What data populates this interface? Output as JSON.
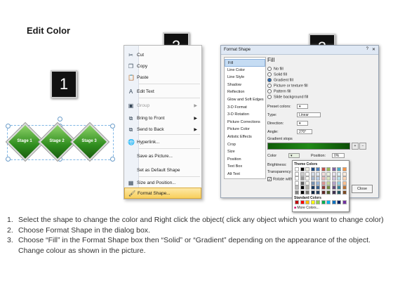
{
  "title": "Edit Color",
  "badges": [
    "1",
    "2",
    "3"
  ],
  "diagram": {
    "stages": [
      "Stage 1",
      "Stage 2",
      "Stage 3"
    ],
    "color": "#2f8d1e"
  },
  "context_menu": {
    "items": [
      {
        "label": "Cut",
        "icon": "scissors-icon",
        "glyph": "✂",
        "disabled": false,
        "submenu": false
      },
      {
        "label": "Copy",
        "icon": "copy-icon",
        "glyph": "❐",
        "disabled": false,
        "submenu": false
      },
      {
        "label": "Paste",
        "icon": "paste-icon",
        "glyph": "📋",
        "disabled": false,
        "submenu": false
      },
      {
        "label": "Edit Text",
        "icon": "text-icon",
        "glyph": "A",
        "disabled": false,
        "submenu": false
      },
      {
        "label": "Group",
        "icon": "group-icon",
        "glyph": "▣",
        "disabled": true,
        "submenu": true
      },
      {
        "label": "Bring to Front",
        "icon": "bring-front-icon",
        "glyph": "⧉",
        "disabled": false,
        "submenu": true
      },
      {
        "label": "Send to Back",
        "icon": "send-back-icon",
        "glyph": "⧉",
        "disabled": false,
        "submenu": true
      },
      {
        "label": "Hyperlink...",
        "icon": "link-icon",
        "glyph": "🌐",
        "disabled": false,
        "submenu": false
      },
      {
        "label": "Save as Picture...",
        "icon": "",
        "glyph": "",
        "disabled": false,
        "submenu": false
      },
      {
        "label": "Set as Default Shape",
        "icon": "",
        "glyph": "",
        "disabled": false,
        "submenu": false
      },
      {
        "label": "Size and Position...",
        "icon": "size-icon",
        "glyph": "▦",
        "disabled": false,
        "submenu": false
      },
      {
        "label": "Format Shape...",
        "icon": "format-shape-icon",
        "glyph": "🖌",
        "disabled": false,
        "submenu": false,
        "highlighted": true
      }
    ]
  },
  "dialog": {
    "title": "Format Shape",
    "nav": [
      "Fill",
      "Line Color",
      "Line Style",
      "Shadow",
      "Reflection",
      "Glow and Soft Edges",
      "3-D Format",
      "3-D Rotation",
      "Picture Corrections",
      "Picture Color",
      "Artistic Effects",
      "Crop",
      "Size",
      "Position",
      "Text Box",
      "Alt Text"
    ],
    "selected_nav": "Fill",
    "section_title": "Fill",
    "fill_options": [
      "No fill",
      "Solid fill",
      "Gradient fill",
      "Picture or texture fill",
      "Pattern fill",
      "Slide background fill"
    ],
    "selected_fill": "Gradient fill",
    "preset_colors_label": "Preset colors:",
    "type_label": "Type:",
    "type_value": "Linear",
    "direction_label": "Direction:",
    "angle_label": "Angle:",
    "angle_value": "270°",
    "gradient_stops_label": "Gradient stops",
    "color_label": "Color",
    "position_label": "Position:",
    "position_value": "0%",
    "brightness_label": "Brightness:",
    "transparency_label": "Transparency:",
    "rotate_label": "Rotate with shape",
    "close_label": "Close",
    "palette": {
      "theme_header": "Theme Colors",
      "standard_header": "Standard Colors",
      "more_label": "More Colors...",
      "theme_top": [
        "#ffffff",
        "#000000",
        "#eeece1",
        "#1f497d",
        "#4f81bd",
        "#c0504d",
        "#9bbb59",
        "#8064a2",
        "#4bacc6",
        "#f79646"
      ],
      "standard": [
        "#c00000",
        "#ff0000",
        "#ffc000",
        "#ffff00",
        "#92d050",
        "#00b050",
        "#00b0f0",
        "#0070c0",
        "#002060",
        "#7030a0"
      ]
    }
  },
  "steps": [
    {
      "num": "1.",
      "text": "Select the shape to change the color and Right click the object( click any object which you want to change color)"
    },
    {
      "num": "2.",
      "text": "Choose Format Shape in the dialog box."
    },
    {
      "num": "3.",
      "text": "Choose “Fill” in the Format Shape box then “Solid” or “Gradient” depending on the appearance of the object. Change colour as shown in the picture."
    }
  ]
}
